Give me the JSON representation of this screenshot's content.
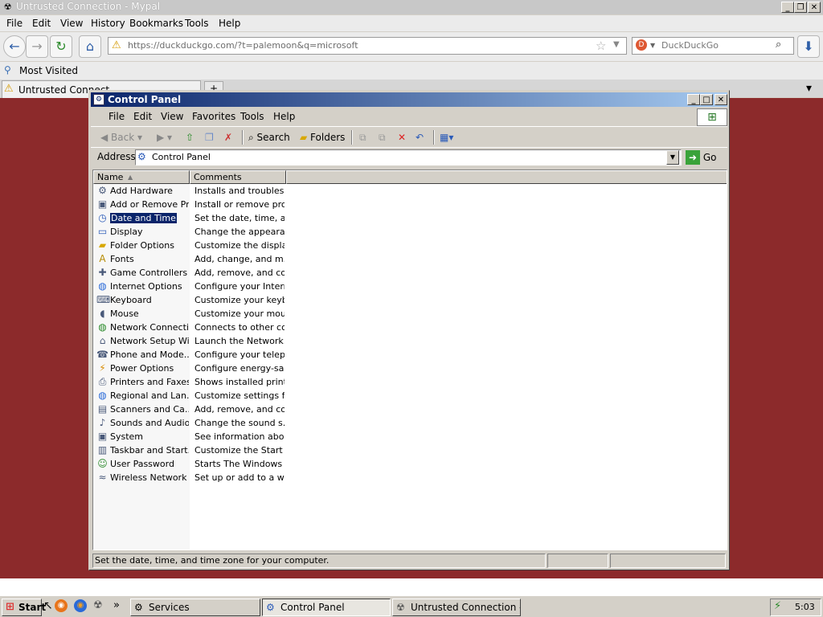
{
  "browser": {
    "title": "Untrusted Connection - Mypal",
    "menu": [
      "File",
      "Edit",
      "View",
      "History",
      "Bookmarks",
      "Tools",
      "Help"
    ],
    "url": "https://duckduckgo.com/?t=palemoon&q=microsoft",
    "search_placeholder": "DuckDuckGo",
    "bookmark": "Most Visited",
    "tab_title": "Untrusted Connect",
    "new_tab": "+",
    "content_color": "#8c2a2b"
  },
  "control_panel": {
    "title": "Control Panel",
    "menu": [
      "File",
      "Edit",
      "View",
      "Favorites",
      "Tools",
      "Help"
    ],
    "toolbar": {
      "back": "Back",
      "search": "Search",
      "folders": "Folders"
    },
    "address_label": "Address",
    "address_value": "Control Panel",
    "go_label": "Go",
    "columns": [
      "Name",
      "Comments"
    ],
    "items": [
      {
        "name": "Add Hardware",
        "comment": "Installs and troublesh...",
        "icon": "hardware-icon"
      },
      {
        "name": "Add or Remove Pr...",
        "comment": "Install or remove pro...",
        "icon": "add-remove-icon"
      },
      {
        "name": "Date and Time",
        "comment": "Set the date, time, a...",
        "icon": "clock-icon",
        "selected": true
      },
      {
        "name": "Display",
        "comment": "Change the appeara...",
        "icon": "display-icon"
      },
      {
        "name": "Folder Options",
        "comment": "Customize the displa...",
        "icon": "folder-options-icon"
      },
      {
        "name": "Fonts",
        "comment": "Add, change, and m...",
        "icon": "fonts-icon"
      },
      {
        "name": "Game Controllers",
        "comment": "Add, remove, and co...",
        "icon": "gamepad-icon"
      },
      {
        "name": "Internet Options",
        "comment": "Configure your Intern...",
        "icon": "globe-icon"
      },
      {
        "name": "Keyboard",
        "comment": "Customize your keyb...",
        "icon": "keyboard-icon"
      },
      {
        "name": "Mouse",
        "comment": "Customize your mous...",
        "icon": "mouse-icon"
      },
      {
        "name": "Network Connecti...",
        "comment": "Connects to other co...",
        "icon": "network-icon"
      },
      {
        "name": "Network Setup Wi...",
        "comment": "Launch the Network...",
        "icon": "network-setup-icon"
      },
      {
        "name": "Phone and Mode...",
        "comment": "Configure your telep...",
        "icon": "phone-icon"
      },
      {
        "name": "Power Options",
        "comment": "Configure energy-sa...",
        "icon": "power-icon"
      },
      {
        "name": "Printers and Faxes",
        "comment": "Shows installed print...",
        "icon": "printer-icon"
      },
      {
        "name": "Regional and Lan...",
        "comment": "Customize settings fo...",
        "icon": "regional-icon"
      },
      {
        "name": "Scanners and Ca...",
        "comment": "Add, remove, and co...",
        "icon": "scanner-icon"
      },
      {
        "name": "Sounds and Audio...",
        "comment": "Change the sound s...",
        "icon": "speaker-icon"
      },
      {
        "name": "System",
        "comment": "See information abo...",
        "icon": "system-icon"
      },
      {
        "name": "Taskbar and Start...",
        "comment": "Customize the Start ...",
        "icon": "taskbar-icon"
      },
      {
        "name": "User Password",
        "comment": "Starts The Windows ...",
        "icon": "users-icon"
      },
      {
        "name": "Wireless Network ...",
        "comment": "Set up or add to a wi...",
        "icon": "wireless-icon"
      }
    ],
    "status": "Set the date, time, and time zone for your computer."
  },
  "taskbar": {
    "start": "Start",
    "overflow": "»",
    "tasks": [
      {
        "label": "Services",
        "active": false
      },
      {
        "label": "Control Panel",
        "active": true
      },
      {
        "label": "Untrusted Connection - M...",
        "active": false
      }
    ],
    "clock": "5:03"
  }
}
